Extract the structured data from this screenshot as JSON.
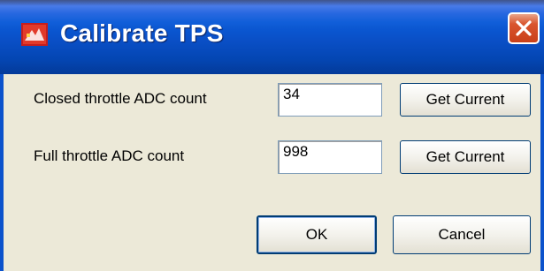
{
  "window": {
    "title": "Calibrate TPS"
  },
  "fields": [
    {
      "label": "Closed throttle ADC count",
      "value": "34",
      "button": "Get Current"
    },
    {
      "label": "Full throttle ADC count",
      "value": "998",
      "button": "Get Current"
    }
  ],
  "actions": {
    "ok_label": "OK",
    "cancel_label": "Cancel"
  },
  "colors": {
    "titlebar": "#0a4fc6",
    "close_button": "#d9552e",
    "dialog_background": "#ece9d8"
  },
  "icons": {
    "app": "app-icon",
    "close": "close-icon"
  }
}
